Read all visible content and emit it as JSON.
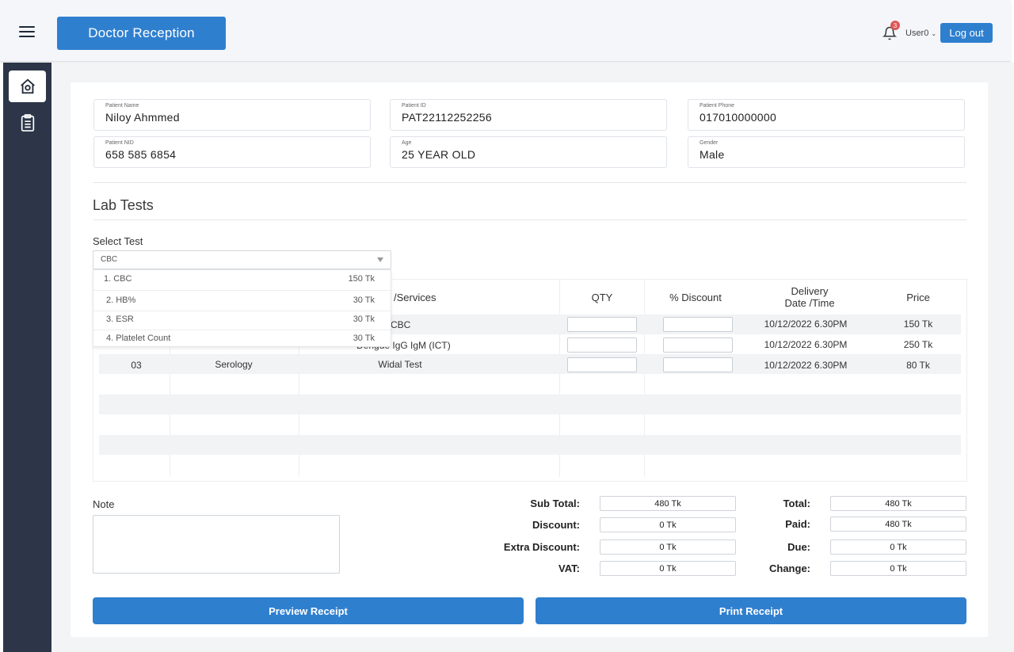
{
  "header": {
    "title": "Doctor Reception",
    "notification_count": "3",
    "user_label": "User0",
    "logout_label": "Log out"
  },
  "patient": {
    "name_label": "Patient Name",
    "name": "Niloy Ahmmed",
    "id_label": "Patient ID",
    "id": "PAT22112252256",
    "phone_label": "Patient Phone",
    "phone": "017010000000",
    "nid_label": "Patient NID",
    "nid": "658 585 6854",
    "age_label": "Age",
    "age": "25 YEAR OLD",
    "gender_label": "Gender",
    "gender": "Male"
  },
  "lab": {
    "title": "Lab Tests",
    "select_label": "Select Test",
    "selected": "CBC",
    "options": [
      {
        "label": "1. CBC",
        "price": "150 Tk"
      },
      {
        "label": "2. HB%",
        "price": "30 Tk"
      },
      {
        "label": "3. ESR",
        "price": "30 Tk"
      },
      {
        "label": "4. Platelet Count",
        "price": "30 Tk"
      }
    ]
  },
  "table": {
    "headers": {
      "services": "/Services",
      "qty": "QTY",
      "discount": "% Discount",
      "delivery_1": "Delivery",
      "delivery_2": "Date /Time",
      "price": "Price"
    },
    "rows": [
      {
        "service": "CBC",
        "delivery": "10/12/2022 6.30PM",
        "price": "150 Tk"
      },
      {
        "service": "Dengue IgG IgM (ICT)",
        "delivery": "10/12/2022 6.30PM",
        "price": "250 Tk"
      },
      {
        "sl": "03",
        "department": "Serology",
        "service": "Widal Test",
        "delivery": "10/12/2022 6.30PM",
        "price": "80 Tk"
      }
    ]
  },
  "note": {
    "label": "Note"
  },
  "totals": {
    "sub_total_label": "Sub Total:",
    "sub_total": "480 Tk",
    "discount_label": "Discount:",
    "discount": "0 Tk",
    "extra_discount_label": "Extra Discount:",
    "extra_discount": "0 Tk",
    "vat_label": "VAT:",
    "vat": "0 Tk",
    "total_label": "Total:",
    "total": "480 Tk",
    "paid_label": "Paid:",
    "paid": "480 Tk",
    "due_label": "Due:",
    "due": "0 Tk",
    "change_label": "Change:",
    "change": "0 Tk"
  },
  "actions": {
    "preview_label": "Preview Receipt",
    "print_label": "Print Receipt"
  },
  "colors": {
    "primary": "#2f7fcf",
    "sidebar": "#2c3648",
    "badge": "#e05656"
  }
}
